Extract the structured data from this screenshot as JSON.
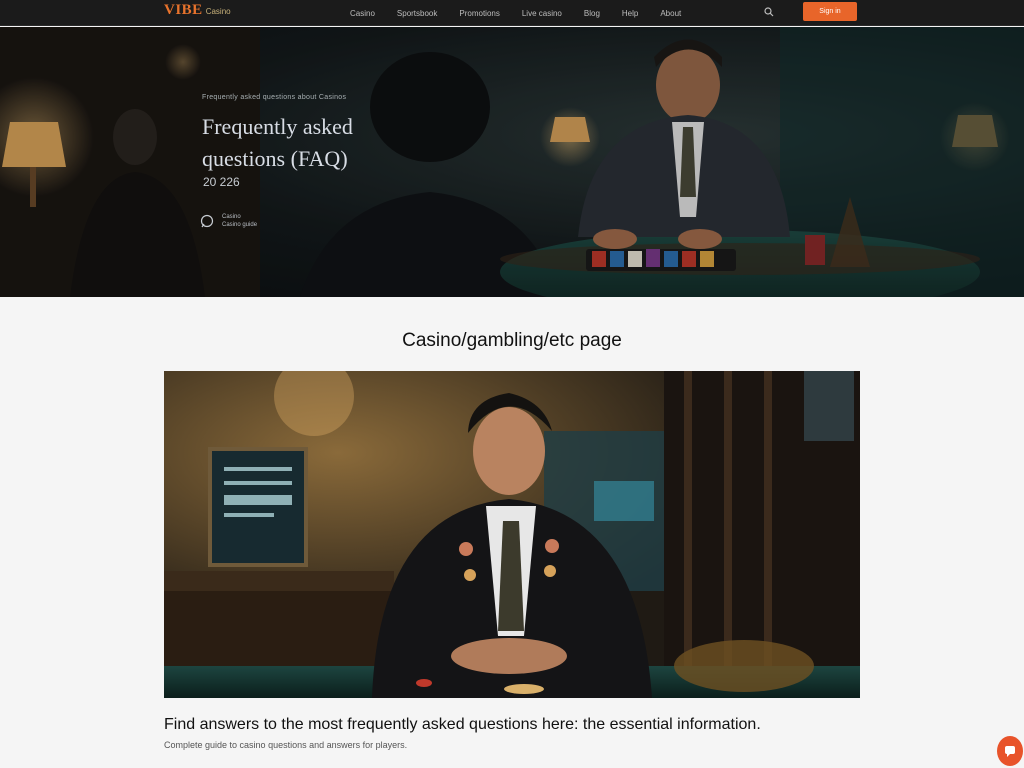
{
  "brand": {
    "logo_main": "VIBE",
    "logo_sub": "Casino"
  },
  "nav": {
    "links": [
      "Casino",
      "Sportsbook",
      "Promotions",
      "Live casino",
      "Blog",
      "Help",
      "About"
    ],
    "search_icon": "search-icon",
    "cta_label": "Sign in"
  },
  "hero": {
    "eyebrow": "Frequently asked questions about Casinos",
    "title_line1": "Frequently asked",
    "title_line2": "questions (FAQ)",
    "year": "20 226",
    "author_line1": "Casino",
    "author_line2": "Casino guide"
  },
  "section": {
    "title": "Casino/gambling/etc page",
    "caption": "Find answers to the most frequently asked questions here: the essential information.",
    "subcaption": "Complete guide to casino questions and answers for players."
  },
  "colors": {
    "nav_bg": "#1b1b1b",
    "accent": "#e8652a",
    "page_bg": "#f5f5f5"
  }
}
